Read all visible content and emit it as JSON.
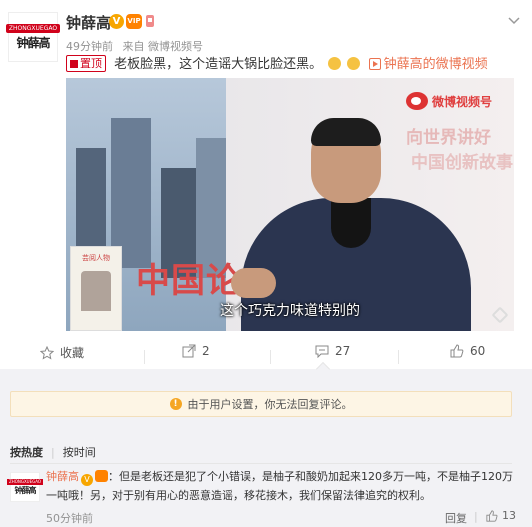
{
  "post": {
    "author": "钟薛高",
    "v_badge": "V",
    "vip_badge": "VIP",
    "avatar_tag": "ZHONGXUEGAO",
    "avatar_brand": "钟薛高",
    "time": "49分钟前",
    "source_prefix": "来自",
    "source": "微博视频号",
    "pin_label": "置顶",
    "text": "老板脸黑，这个造谣大锅比脸还黑。",
    "video_link": "钟薛高的微博视频",
    "more_icon": "chevron-down-icon"
  },
  "video": {
    "watermark": "微博视频号",
    "wall_text_1": "向世界讲好",
    "wall_text_2": "中国创新故事",
    "big_text": "中国论",
    "book_title": "芸阅人物",
    "subtitle": "这个巧克力味道特别的"
  },
  "actions": {
    "favorite_label": "收藏",
    "repost_count": "2",
    "comment_count": "27",
    "like_count": "60"
  },
  "comments": {
    "notice": "由于用户设置，你无法回复评论。",
    "sort_hot": "按热度",
    "sort_time": "按时间",
    "items": [
      {
        "author": "钟薛高",
        "text": "：但是老板还是犯了个小错误，是柚子和酸奶加起来120多万一吨，不是柚子120万一吨哦！另，对于别有用心的恶意造谣，移花接木，我们保留法律追究的权利。",
        "time": "50分钟前",
        "report": "回复",
        "like_count": "13"
      }
    ]
  }
}
